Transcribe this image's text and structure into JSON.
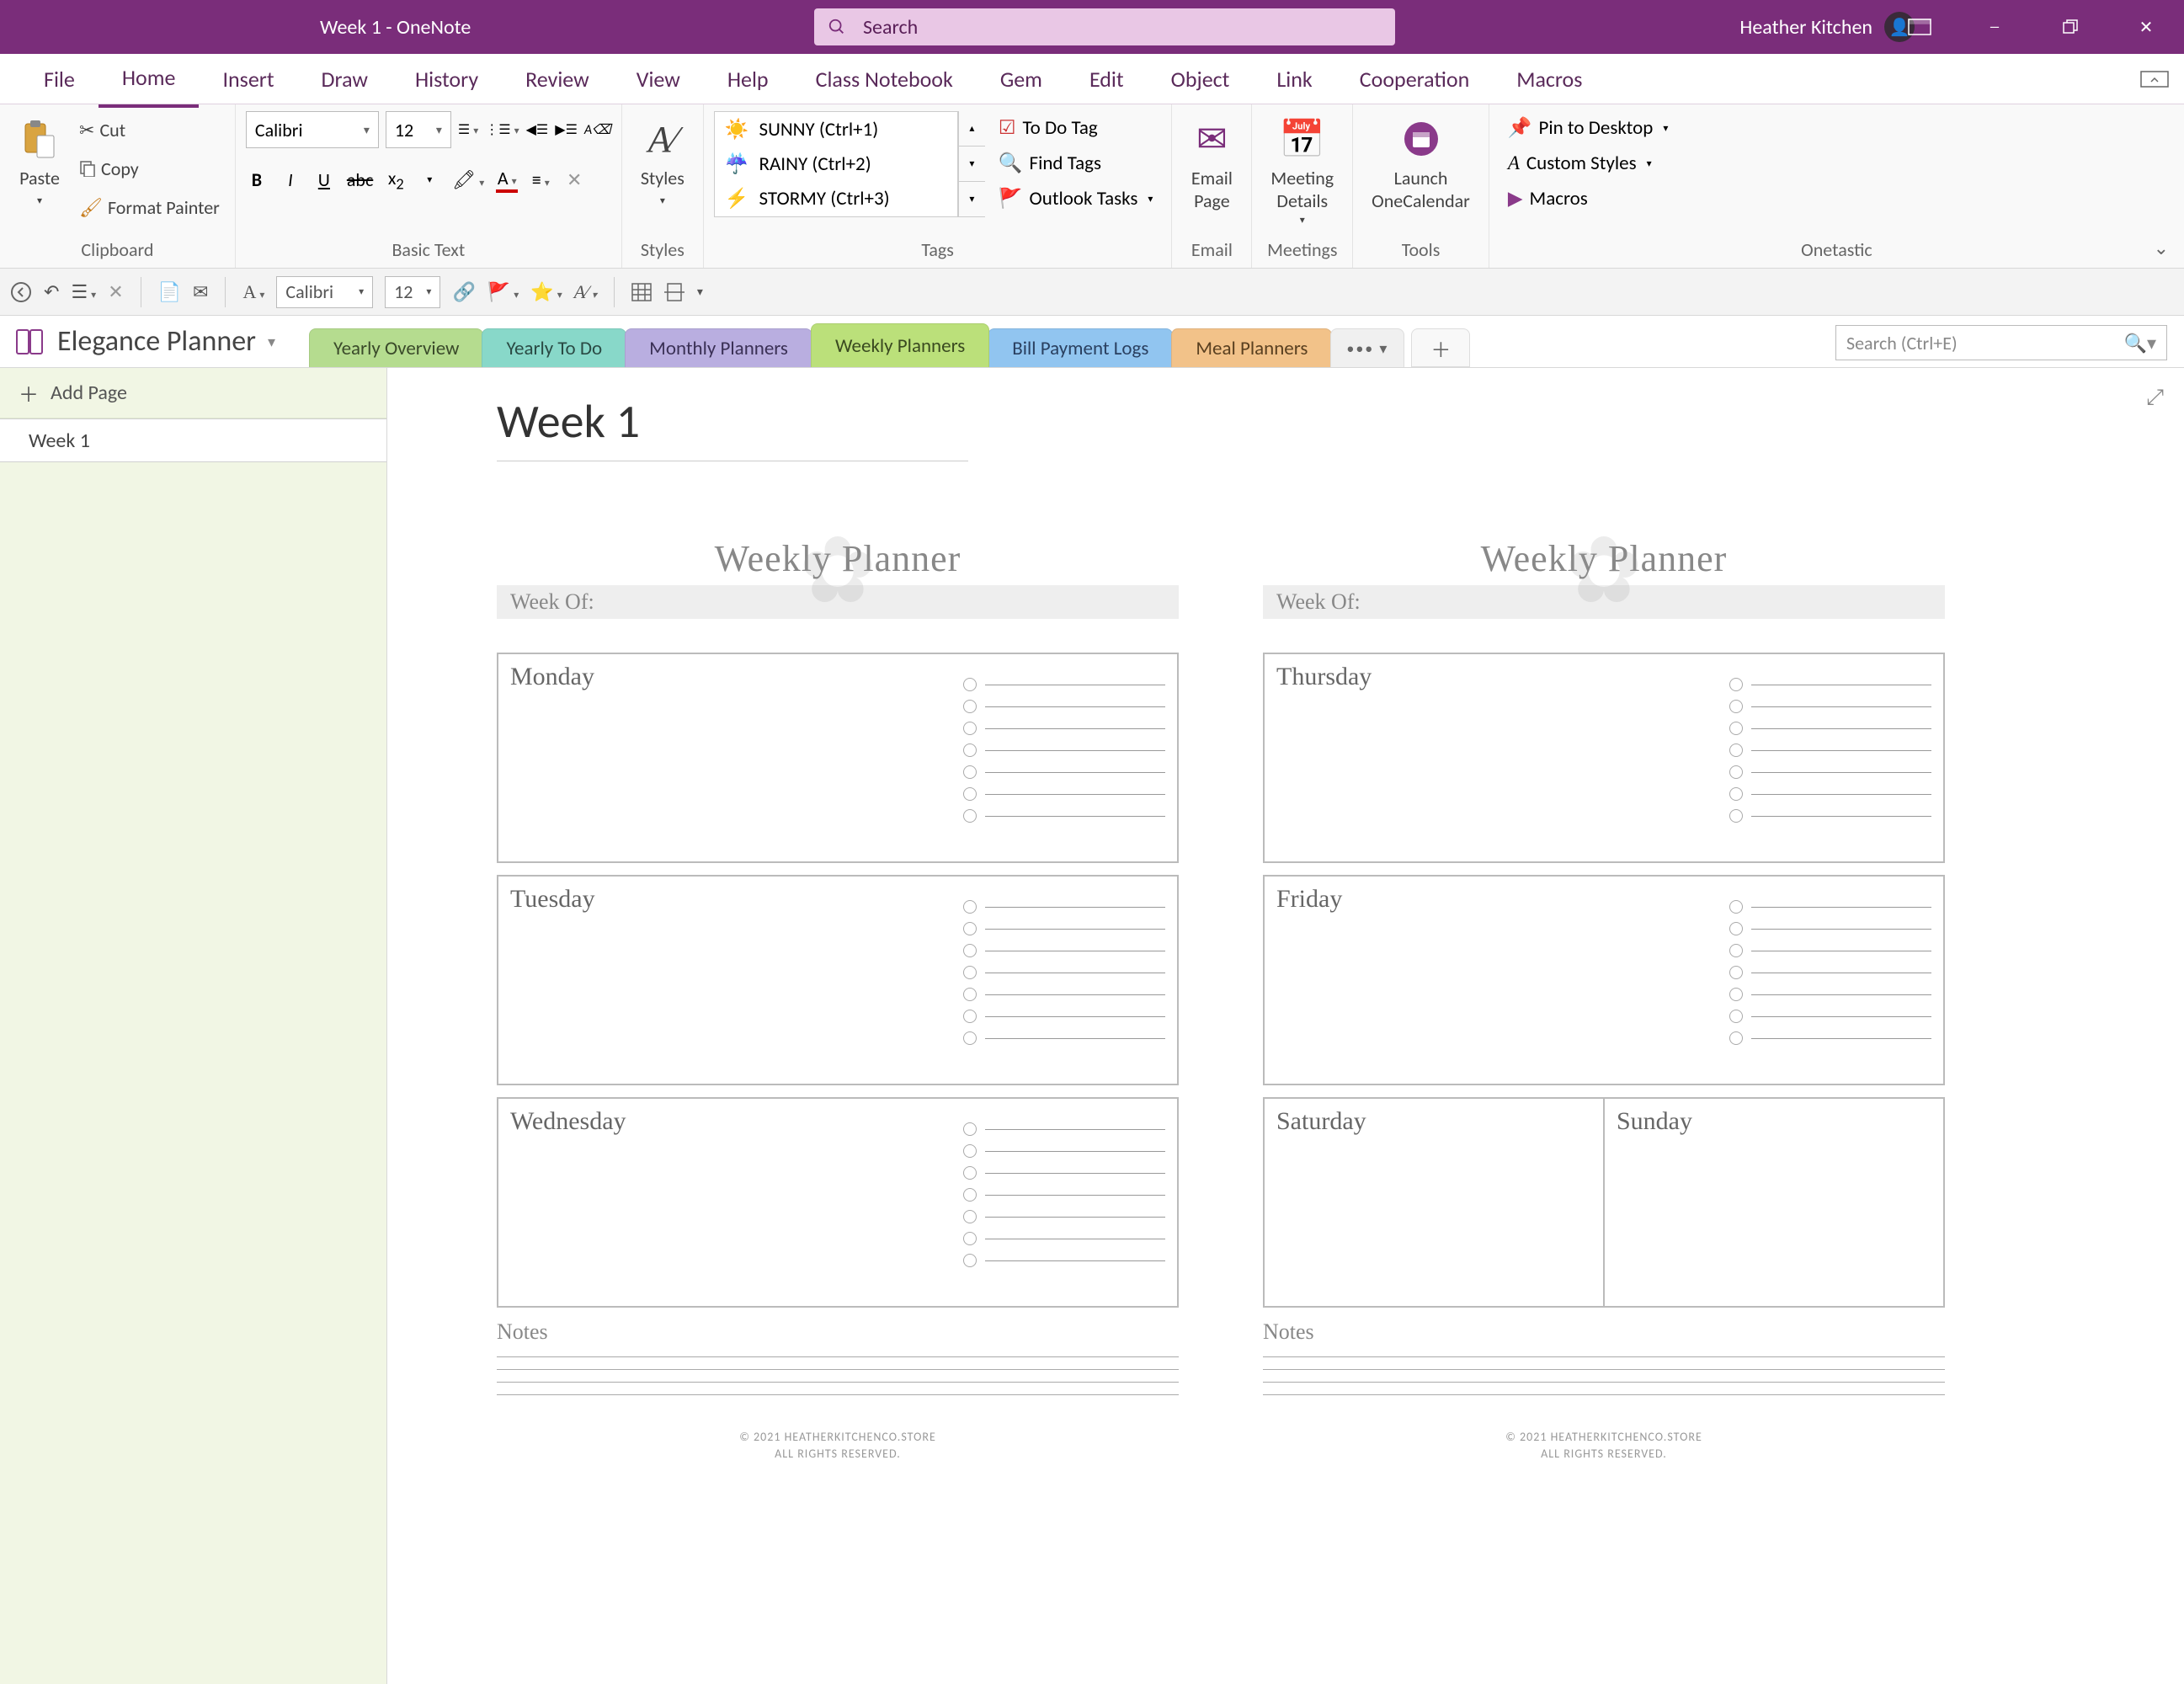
{
  "titlebar": {
    "title": "Week 1  -  OneNote",
    "search_placeholder": "Search",
    "user_name": "Heather Kitchen"
  },
  "menu": {
    "items": [
      "File",
      "Home",
      "Insert",
      "Draw",
      "History",
      "Review",
      "View",
      "Help",
      "Class Notebook",
      "Gem",
      "Edit",
      "Object",
      "Link",
      "Cooperation",
      "Macros"
    ],
    "active": "Home"
  },
  "ribbon": {
    "clipboard": {
      "paste": "Paste",
      "cut": "Cut",
      "copy": "Copy",
      "format_painter": "Format Painter",
      "label": "Clipboard"
    },
    "basic_text": {
      "font": "Calibri",
      "size": "12",
      "label": "Basic Text"
    },
    "styles": {
      "styles": "Styles",
      "label": "Styles"
    },
    "tags": {
      "list": [
        "SUNNY (Ctrl+1)",
        "RAINY (Ctrl+2)",
        "STORMY (Ctrl+3)"
      ],
      "todo": "To Do Tag",
      "find": "Find Tags",
      "outlook": "Outlook Tasks",
      "label": "Tags"
    },
    "email": {
      "btn": "Email\nPage",
      "label": "Email"
    },
    "meetings": {
      "btn": "Meeting\nDetails",
      "label": "Meetings"
    },
    "tools": {
      "btn": "Launch\nOneCalendar",
      "label": "Tools"
    },
    "onetastic": {
      "pin": "Pin to Desktop",
      "custom": "Custom Styles",
      "macros": "Macros",
      "label": "Onetastic"
    }
  },
  "qat": {
    "font": "Calibri",
    "size": "12"
  },
  "notebook": {
    "name": "Elegance Planner",
    "sections": [
      "Yearly Overview",
      "Yearly To Do",
      "Monthly Planners",
      "Weekly Planners",
      "Bill Payment Logs",
      "Meal Planners"
    ],
    "search_placeholder": "Search (Ctrl+E)"
  },
  "sidebar": {
    "add_page": "Add Page",
    "pages": [
      "Week 1"
    ]
  },
  "page": {
    "title": "Week 1",
    "planner_title": "Weekly Planner",
    "week_of": "Week Of:",
    "days_left": [
      "Monday",
      "Tuesday",
      "Wednesday"
    ],
    "days_right_top": [
      "Thursday",
      "Friday"
    ],
    "days_right_split": [
      "Saturday",
      "Sunday"
    ],
    "notes": "Notes",
    "copyright1": "© 2021 HEATHERKITCHENCO.STORE",
    "copyright2": "ALL RIGHTS RESERVED."
  }
}
